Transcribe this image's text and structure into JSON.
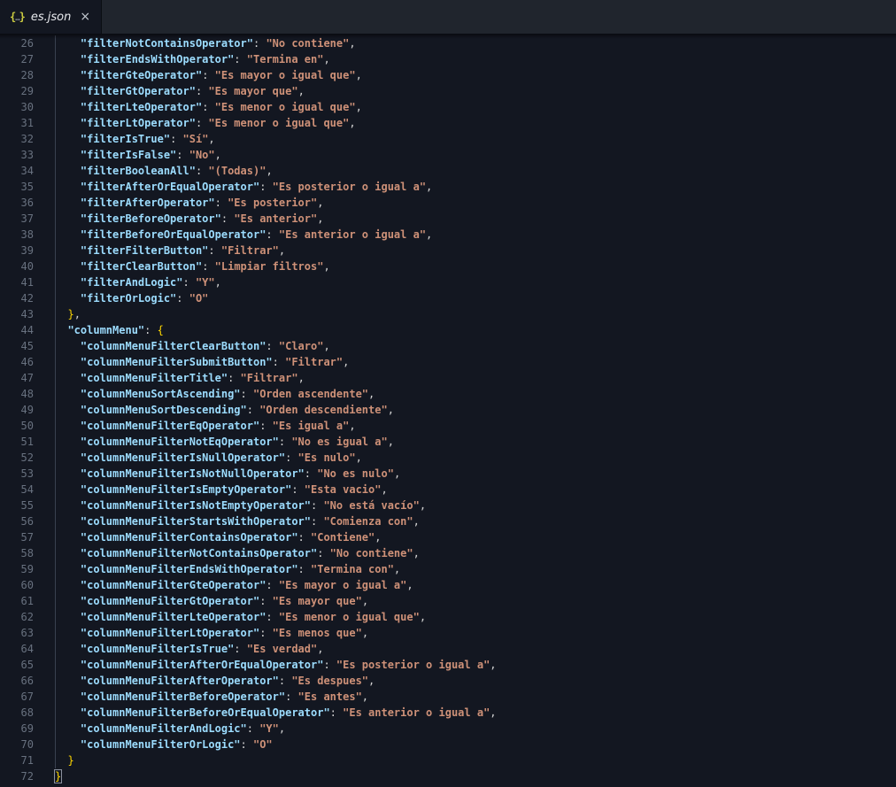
{
  "window": {
    "app": "code-editor"
  },
  "tab": {
    "label": "es.json",
    "icon": {
      "open": "{",
      "dots": "…",
      "close": "}"
    },
    "close_symbol": "×"
  },
  "colors": {
    "editor_background": "#131721",
    "tabbar_background": "#20252d",
    "key_color": "#9cdcfe",
    "string_color": "#ce9178",
    "punctuation_color": "#d4d4d4",
    "brace_color": "#ffd700",
    "line_number_color": "#68717f",
    "json_icon_color": "#cbcb41"
  },
  "editor": {
    "first_line_number": 26,
    "last_line_number": 72,
    "lines": [
      {
        "n": 26,
        "indent": 4,
        "key": "filterNotContainsOperator",
        "value": "No contiene",
        "comma": true
      },
      {
        "n": 27,
        "indent": 4,
        "key": "filterEndsWithOperator",
        "value": "Termina en",
        "comma": true
      },
      {
        "n": 28,
        "indent": 4,
        "key": "filterGteOperator",
        "value": "Es mayor o igual que",
        "comma": true
      },
      {
        "n": 29,
        "indent": 4,
        "key": "filterGtOperator",
        "value": "Es mayor que",
        "comma": true
      },
      {
        "n": 30,
        "indent": 4,
        "key": "filterLteOperator",
        "value": "Es menor o igual que",
        "comma": true
      },
      {
        "n": 31,
        "indent": 4,
        "key": "filterLtOperator",
        "value": "Es menor o igual que",
        "comma": true
      },
      {
        "n": 32,
        "indent": 4,
        "key": "filterIsTrue",
        "value": "Sí",
        "comma": true
      },
      {
        "n": 33,
        "indent": 4,
        "key": "filterIsFalse",
        "value": "No",
        "comma": true
      },
      {
        "n": 34,
        "indent": 4,
        "key": "filterBooleanAll",
        "value": "(Todas)",
        "comma": true
      },
      {
        "n": 35,
        "indent": 4,
        "key": "filterAfterOrEqualOperator",
        "value": "Es posterior o igual a",
        "comma": true
      },
      {
        "n": 36,
        "indent": 4,
        "key": "filterAfterOperator",
        "value": "Es posterior",
        "comma": true
      },
      {
        "n": 37,
        "indent": 4,
        "key": "filterBeforeOperator",
        "value": "Es anterior",
        "comma": true
      },
      {
        "n": 38,
        "indent": 4,
        "key": "filterBeforeOrEqualOperator",
        "value": "Es anterior o igual a",
        "comma": true
      },
      {
        "n": 39,
        "indent": 4,
        "key": "filterFilterButton",
        "value": "Filtrar",
        "comma": true
      },
      {
        "n": 40,
        "indent": 4,
        "key": "filterClearButton",
        "value": "Limpiar filtros",
        "comma": true
      },
      {
        "n": 41,
        "indent": 4,
        "key": "filterAndLogic",
        "value": "Y",
        "comma": true
      },
      {
        "n": 42,
        "indent": 4,
        "key": "filterOrLogic",
        "value": "O",
        "comma": false
      },
      {
        "n": 43,
        "indent": 2,
        "close": "}",
        "comma": true
      },
      {
        "n": 44,
        "indent": 2,
        "key": "columnMenu",
        "open": "{"
      },
      {
        "n": 45,
        "indent": 4,
        "key": "columnMenuFilterClearButton",
        "value": "Claro",
        "comma": true
      },
      {
        "n": 46,
        "indent": 4,
        "key": "columnMenuFilterSubmitButton",
        "value": "Filtrar",
        "comma": true
      },
      {
        "n": 47,
        "indent": 4,
        "key": "columnMenuFilterTitle",
        "value": "Filtrar",
        "comma": true
      },
      {
        "n": 48,
        "indent": 4,
        "key": "columnMenuSortAscending",
        "value": "Orden ascendente",
        "comma": true
      },
      {
        "n": 49,
        "indent": 4,
        "key": "columnMenuSortDescending",
        "value": "Orden descendiente",
        "comma": true
      },
      {
        "n": 50,
        "indent": 4,
        "key": "columnMenuFilterEqOperator",
        "value": "Es igual a",
        "comma": true
      },
      {
        "n": 51,
        "indent": 4,
        "key": "columnMenuFilterNotEqOperator",
        "value": "No es igual a",
        "comma": true
      },
      {
        "n": 52,
        "indent": 4,
        "key": "columnMenuFilterIsNullOperator",
        "value": "Es nulo",
        "comma": true
      },
      {
        "n": 53,
        "indent": 4,
        "key": "columnMenuFilterIsNotNullOperator",
        "value": "No es nulo",
        "comma": true
      },
      {
        "n": 54,
        "indent": 4,
        "key": "columnMenuFilterIsEmptyOperator",
        "value": "Esta vacio",
        "comma": true
      },
      {
        "n": 55,
        "indent": 4,
        "key": "columnMenuFilterIsNotEmptyOperator",
        "value": "No está vacío",
        "comma": true
      },
      {
        "n": 56,
        "indent": 4,
        "key": "columnMenuFilterStartsWithOperator",
        "value": "Comienza con",
        "comma": true
      },
      {
        "n": 57,
        "indent": 4,
        "key": "columnMenuFilterContainsOperator",
        "value": "Contiene",
        "comma": true
      },
      {
        "n": 58,
        "indent": 4,
        "key": "columnMenuFilterNotContainsOperator",
        "value": "No contiene",
        "comma": true
      },
      {
        "n": 59,
        "indent": 4,
        "key": "columnMenuFilterEndsWithOperator",
        "value": "Termina con",
        "comma": true
      },
      {
        "n": 60,
        "indent": 4,
        "key": "columnMenuFilterGteOperator",
        "value": "Es mayor o igual a",
        "comma": true
      },
      {
        "n": 61,
        "indent": 4,
        "key": "columnMenuFilterGtOperator",
        "value": "Es mayor que",
        "comma": true
      },
      {
        "n": 62,
        "indent": 4,
        "key": "columnMenuFilterLteOperator",
        "value": "Es menor o igual que",
        "comma": true
      },
      {
        "n": 63,
        "indent": 4,
        "key": "columnMenuFilterLtOperator",
        "value": "Es menos que",
        "comma": true
      },
      {
        "n": 64,
        "indent": 4,
        "key": "columnMenuFilterIsTrue",
        "value": "Es verdad",
        "comma": true
      },
      {
        "n": 65,
        "indent": 4,
        "key": "columnMenuFilterAfterOrEqualOperator",
        "value": "Es posterior o igual a",
        "comma": true
      },
      {
        "n": 66,
        "indent": 4,
        "key": "columnMenuFilterAfterOperator",
        "value": "Es despues",
        "comma": true
      },
      {
        "n": 67,
        "indent": 4,
        "key": "columnMenuFilterBeforeOperator",
        "value": "Es antes",
        "comma": true
      },
      {
        "n": 68,
        "indent": 4,
        "key": "columnMenuFilterBeforeOrEqualOperator",
        "value": "Es anterior o igual a",
        "comma": true
      },
      {
        "n": 69,
        "indent": 4,
        "key": "columnMenuFilterAndLogic",
        "value": "Y",
        "comma": true
      },
      {
        "n": 70,
        "indent": 4,
        "key": "columnMenuFilterOrLogic",
        "value": "O",
        "comma": false
      },
      {
        "n": 71,
        "indent": 2,
        "close": "}",
        "comma": false
      },
      {
        "n": 72,
        "indent": 0,
        "close": "}",
        "comma": false,
        "matched": true
      }
    ]
  }
}
